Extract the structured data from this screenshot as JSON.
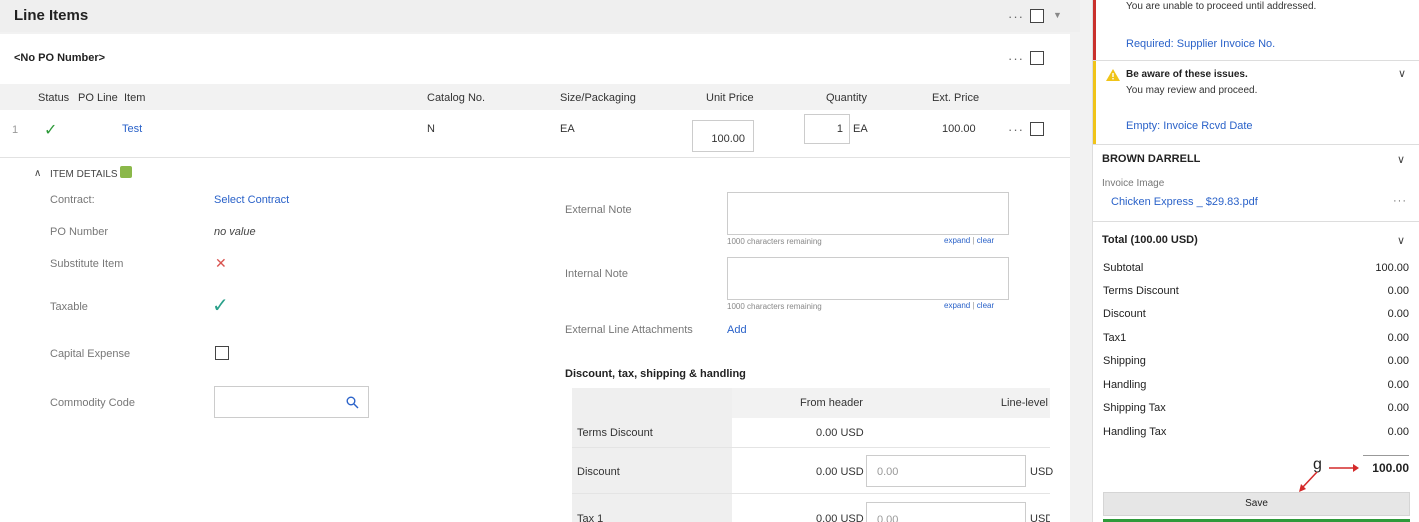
{
  "line_items": {
    "title": "Line Items",
    "po_title": "<No PO Number>",
    "columns": {
      "status": "Status",
      "po_line": "PO Line",
      "item": "Item",
      "catalog": "Catalog No.",
      "size": "Size/Packaging",
      "unit_price": "Unit Price",
      "quantity": "Quantity",
      "ext_price": "Ext. Price"
    },
    "row": {
      "index": "1",
      "status_icon": "check-icon",
      "item": "Test",
      "catalog": "N",
      "size": "EA",
      "unit_price": "100.00",
      "quantity": "1",
      "quantity_unit": "EA",
      "ext_price": "100.00"
    },
    "dots": "···"
  },
  "item_details": {
    "toggle_label": "ITEM DETAILS",
    "contract_label": "Contract:",
    "contract_value": "Select Contract",
    "po_number_label": "PO Number",
    "po_number_value": "no value",
    "substitute_label": "Substitute Item",
    "taxable_label": "Taxable",
    "capital_label": "Capital Expense",
    "commodity_label": "Commodity Code",
    "external_note_label": "External Note",
    "internal_note_label": "Internal Note",
    "chars_remaining": "1000 characters remaining",
    "expand": "expand",
    "sep": "|",
    "clear": "clear",
    "attachments_label": "External Line Attachments",
    "attachments_add": "Add"
  },
  "dtsh": {
    "title": "Discount, tax, shipping & handling",
    "col_from_header": "From header",
    "col_line_level": "Line-level",
    "rows": [
      {
        "label": "Terms Discount",
        "from_header": "0.00 USD",
        "line_value": "",
        "unit": ""
      },
      {
        "label": "Discount",
        "from_header": "0.00 USD",
        "line_value": "0.00",
        "unit": "USD"
      },
      {
        "label": "Tax 1",
        "from_header": "0.00 USD",
        "line_value": "0.00",
        "unit": "USD"
      }
    ]
  },
  "right_panel": {
    "error_text": "You are unable to proceed until addressed.",
    "error_link": "Required: Supplier Invoice No.",
    "warn_title": "Be aware of these issues.",
    "warn_text": "You may review and proceed.",
    "warn_link": "Empty: Invoice Rcvd Date",
    "supplier_name": "BROWN DARRELL",
    "invoice_image_label": "Invoice Image",
    "invoice_file": "Chicken Express _ $29.83.pdf",
    "dots": "···",
    "total_title": "Total (100.00 USD)",
    "totals": [
      {
        "label": "Subtotal",
        "value": "100.00"
      },
      {
        "label": "Terms Discount",
        "value": "0.00"
      },
      {
        "label": "Discount",
        "value": "0.00"
      },
      {
        "label": "Tax1",
        "value": "0.00"
      },
      {
        "label": "Shipping",
        "value": "0.00"
      },
      {
        "label": "Handling",
        "value": "0.00"
      },
      {
        "label": "Shipping Tax",
        "value": "0.00"
      },
      {
        "label": "Handling Tax",
        "value": "0.00"
      }
    ],
    "grand_total": "100.00",
    "annotation_letter": "g",
    "save_label": "Save"
  },
  "colors": {
    "link": "#2a62c9",
    "error_bar": "#c9302c",
    "warn_bar": "#f0c419",
    "check": "#2e9a3a",
    "annotation": "#d42a2a"
  }
}
